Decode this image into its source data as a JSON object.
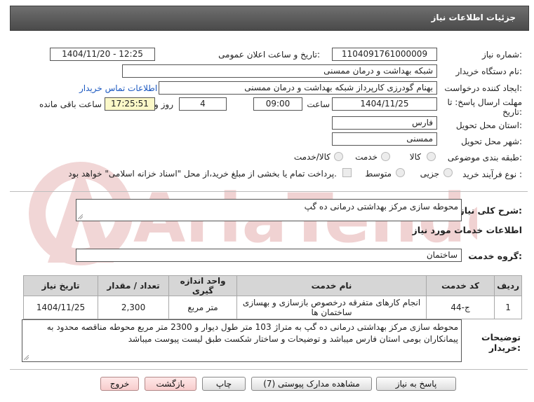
{
  "header": {
    "title": "جزئیات اطلاعات نیاز"
  },
  "form": {
    "need_number_label": "شماره نیاز:",
    "need_number": "1104091761000009",
    "announce_label": "تاریخ و ساعت اعلان عمومی:",
    "announce_value": "1404/11/20 - 12:25",
    "buyer_org_label": "نام دستگاه خریدار:",
    "buyer_org": "شبکه بهداشت و درمان ممسنی",
    "creator_label": "ایجاد کننده درخواست:",
    "creator": "بهنام  گودرزی کارپرداز شبکه بهداشت و درمان ممسنی",
    "contact_link": "اطلاعات تماس خریدار",
    "deadline_label_1": "مهلت ارسال پاسخ: تا",
    "deadline_label_2": "تاریخ:",
    "deadline_date": "1404/11/25",
    "time_label": "ساعت",
    "deadline_time": "09:00",
    "days_count": "4",
    "days_label": "روز و",
    "remaining_time": "17:25:51",
    "remaining_label": "ساعت باقی مانده",
    "province_label": "استان محل تحویل:",
    "province": "فارس",
    "city_label": "شهر محل تحویل:",
    "city": "ممسنی",
    "category_label": "طبقه بندی موضوعی:",
    "category_options": [
      "کالا",
      "خدمت",
      "کالا/خدمت"
    ],
    "process_label": "نوع فرآیند خرید :",
    "process_options": [
      "جزیی",
      "متوسط"
    ],
    "payment_note": "پرداخت تمام یا بخشی از مبلغ خرید،از محل \"اسناد خزانه اسلامی\" خواهد بود."
  },
  "summary": {
    "label": "شرح کلی نیاز:",
    "text": "محوطه سازی مرکز بهداشتی درمانی ده گپ"
  },
  "services_title": "اطلاعات خدمات مورد نیاز",
  "service_group": {
    "label": "گروه خدمت:",
    "value": "ساختمان"
  },
  "table": {
    "headers": [
      "ردیف",
      "کد خدمت",
      "نام خدمت",
      "واحد اندازه گیری",
      "تعداد / مقدار",
      "تاریخ نیاز"
    ],
    "rows": [
      {
        "row": "1",
        "code": "ج-44",
        "name": "انجام کارهای متفرقه درخصوص بازسازی و بهسازی ساختمان ها",
        "unit": "متر مربع",
        "qty": "2,300",
        "date": "1404/11/25"
      }
    ]
  },
  "buyer_notes": {
    "label_1": "توضیحات",
    "label_2": "خریدار:",
    "text": "محوطه سازی مرکز بهداشتی درمانی ده گپ به متراژ 103 متر طول دیوار و 2300 متر مربع محوطه مناقصه محدود به پیمانکاران بومی استان فارس میباشد و توضیحات و ساختار شکست طبق لیست پیوست میباشد"
  },
  "buttons": {
    "reply": "پاسخ به نیاز",
    "attachments": "مشاهده مدارک پیوستی (7)",
    "print": "چاپ",
    "back": "بازگشت",
    "exit": "خروج"
  },
  "watermark": {
    "text": "AriaTender.neT",
    "color": "#f0d2d2"
  }
}
